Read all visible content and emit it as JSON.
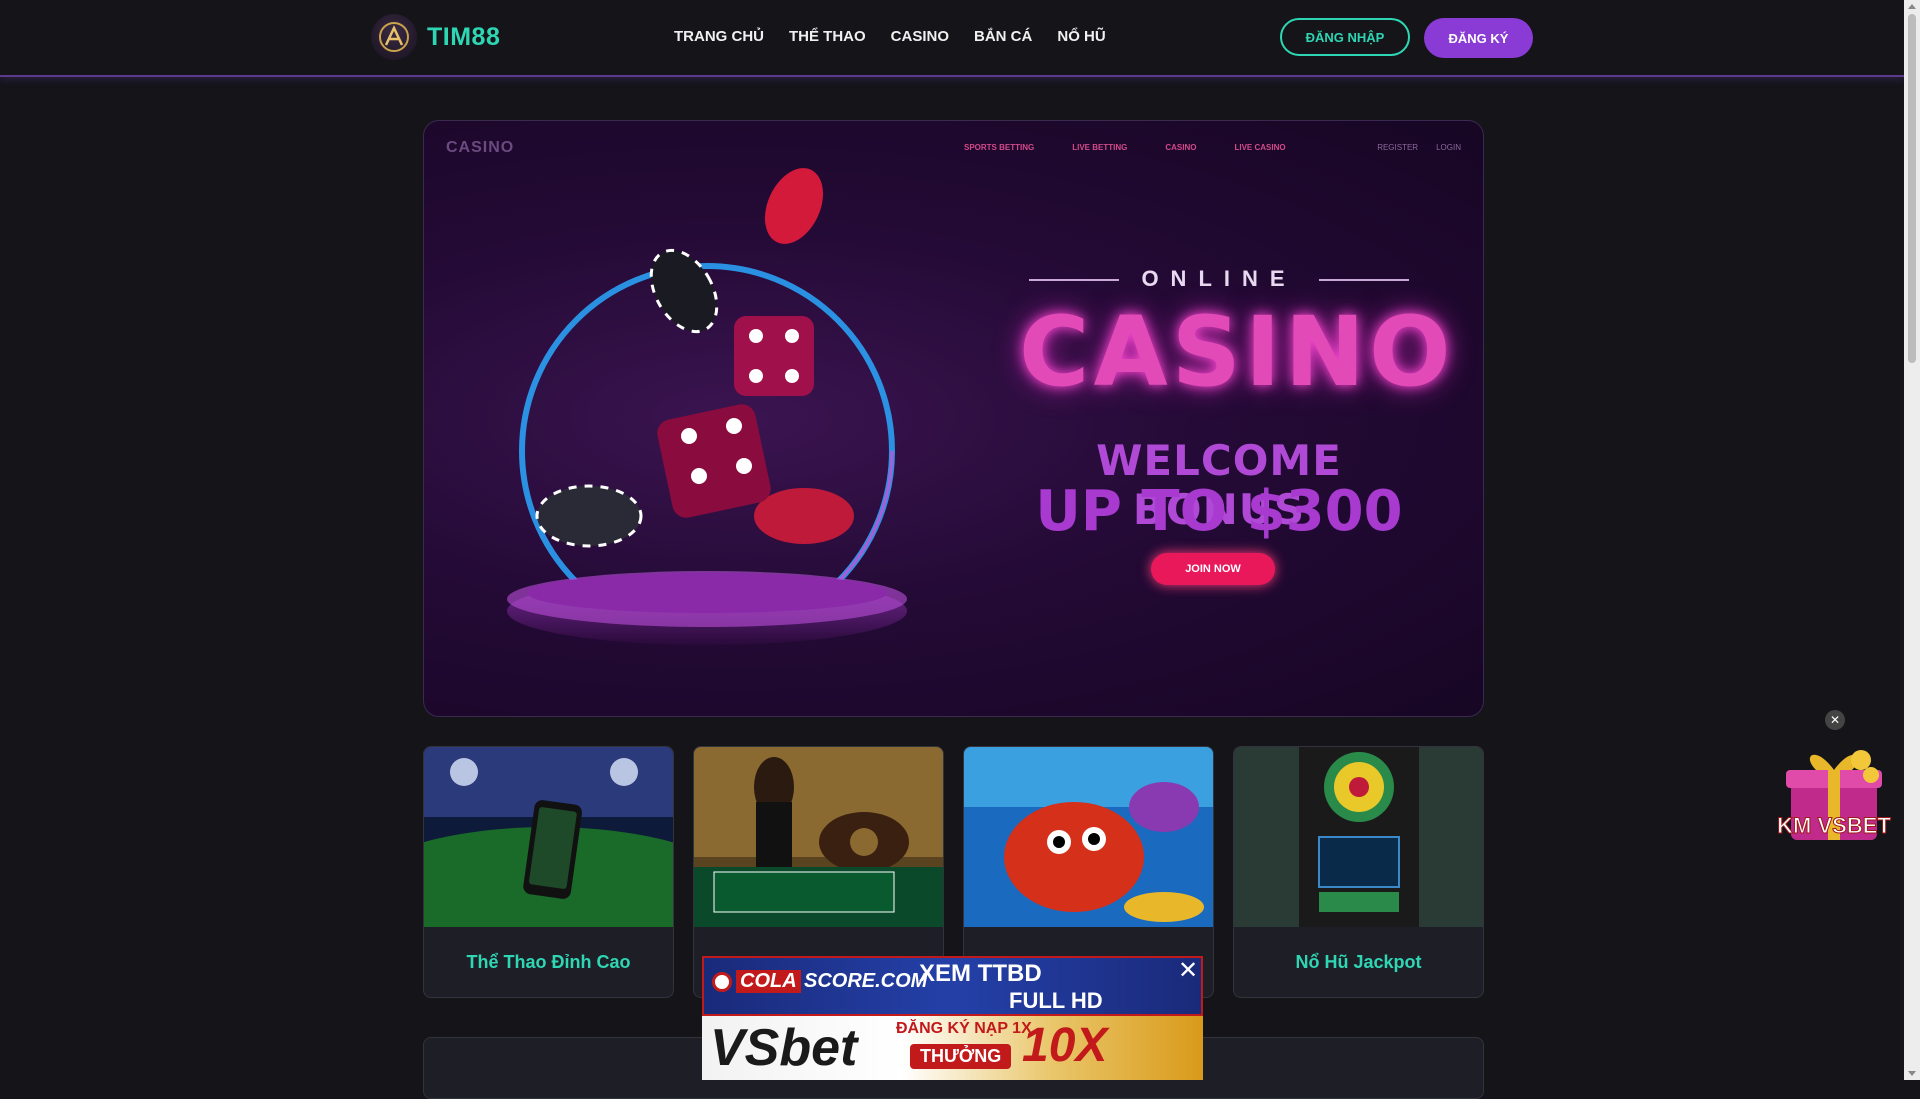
{
  "header": {
    "brand": "TIM88",
    "nav": [
      "TRANG CHỦ",
      "THỂ THAO",
      "CASINO",
      "BẮN CÁ",
      "NỔ HŨ"
    ],
    "login": "ĐĂNG NHẬP",
    "register": "ĐĂNG KÝ"
  },
  "hero": {
    "brand": "CASINO",
    "links": [
      "SPORTS BETTING",
      "LIVE BETTING",
      "CASINO",
      "LIVE CASINO"
    ],
    "right_links": [
      "REGISTER",
      "LOGIN"
    ],
    "online": "ONLINE",
    "casino": "CASINO",
    "welcome": "WELCOME BONUS",
    "upto": "UP TO $300",
    "join": "JOIN NOW"
  },
  "cards": [
    {
      "title": "Thể Thao Đỉnh Cao"
    },
    {
      "title": ""
    },
    {
      "title": ""
    },
    {
      "title": "Nổ Hũ Jackpot"
    }
  ],
  "ads": {
    "cola_brand": "COLA",
    "cola_domain": "SCORE.COM",
    "cola_text1": "XEM TTBD",
    "cola_text2": "FULL HD",
    "vsbet_brand": "VSbet",
    "vsbet_promo1": "ĐĂNG KÝ NẠP 1X",
    "vsbet_promo2": "THƯỞNG",
    "vsbet_multiplier": "10X"
  },
  "gift": {
    "label": "KM VSBET"
  },
  "colors": {
    "accent": "#2fd6b4",
    "purple": "#8a3bd6",
    "bg": "#141419"
  }
}
